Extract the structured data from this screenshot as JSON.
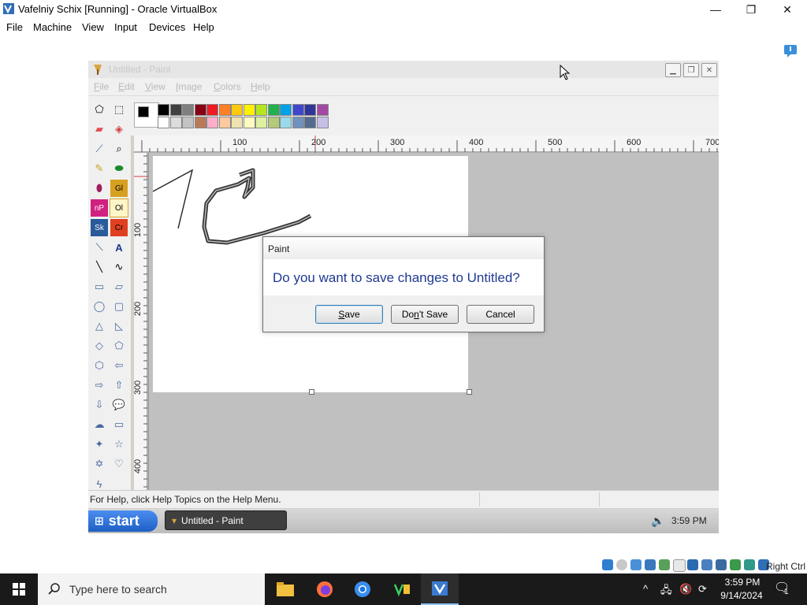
{
  "host": {
    "title": "Vafelniy  Schix [Running] - Oracle VirtualBox",
    "menu": [
      "File",
      "Machine",
      "View",
      "Input",
      "Devices",
      "Help"
    ],
    "controls": {
      "minimize": "—",
      "maximize": "❐",
      "close": "✕"
    }
  },
  "paint": {
    "title": "Untitled - Paint",
    "menu": [
      {
        "label": "File",
        "key": "F"
      },
      {
        "label": "Edit",
        "key": "E"
      },
      {
        "label": "View",
        "key": "V"
      },
      {
        "label": "Image",
        "key": "I"
      },
      {
        "label": "Colors",
        "key": "C"
      },
      {
        "label": "Help",
        "key": "H"
      }
    ],
    "ruler_top": [
      "100",
      "200",
      "300",
      "400",
      "500",
      "600",
      "700"
    ],
    "ruler_left": [
      "100",
      "200",
      "300",
      "400"
    ],
    "palette_row1": [
      "#000000",
      "#404040",
      "#7f7f7f",
      "#880015",
      "#ed1c24",
      "#ff7f27",
      "#ffc90e",
      "#fff200",
      "#b5e61d",
      "#22b14c",
      "#00a2e8",
      "#3f48cc",
      "#2f3699",
      "#a349a4"
    ],
    "palette_row2": [
      "#ffffff",
      "#dcdcdc",
      "#c3c3c3",
      "#b97a57",
      "#ffaec9",
      "#ffc9a0",
      "#efe4b0",
      "#fffbc0",
      "#e0f0a0",
      "#b5c97a",
      "#99d9ea",
      "#7092be",
      "#546d8e",
      "#c8bfe7"
    ],
    "status": "For Help, click Help Topics on the Help Menu."
  },
  "xp_taskbar": {
    "start_label": "start",
    "task_label": "Untitled - Paint",
    "clock": "3:59 PM"
  },
  "dialog": {
    "title": "Paint",
    "message": "Do you want to save changes to Untitled?",
    "save": {
      "pre": "",
      "key": "S",
      "post": "ave"
    },
    "dont_save": {
      "pre": "Do",
      "key": "n",
      "post": "'t Save"
    },
    "cancel": "Cancel"
  },
  "vbox_status": {
    "host_key": "Right Ctrl"
  },
  "win_taskbar": {
    "search_placeholder": "Type here to search",
    "time": "3:59 PM",
    "date": "9/14/2024",
    "notification_count": "1"
  }
}
